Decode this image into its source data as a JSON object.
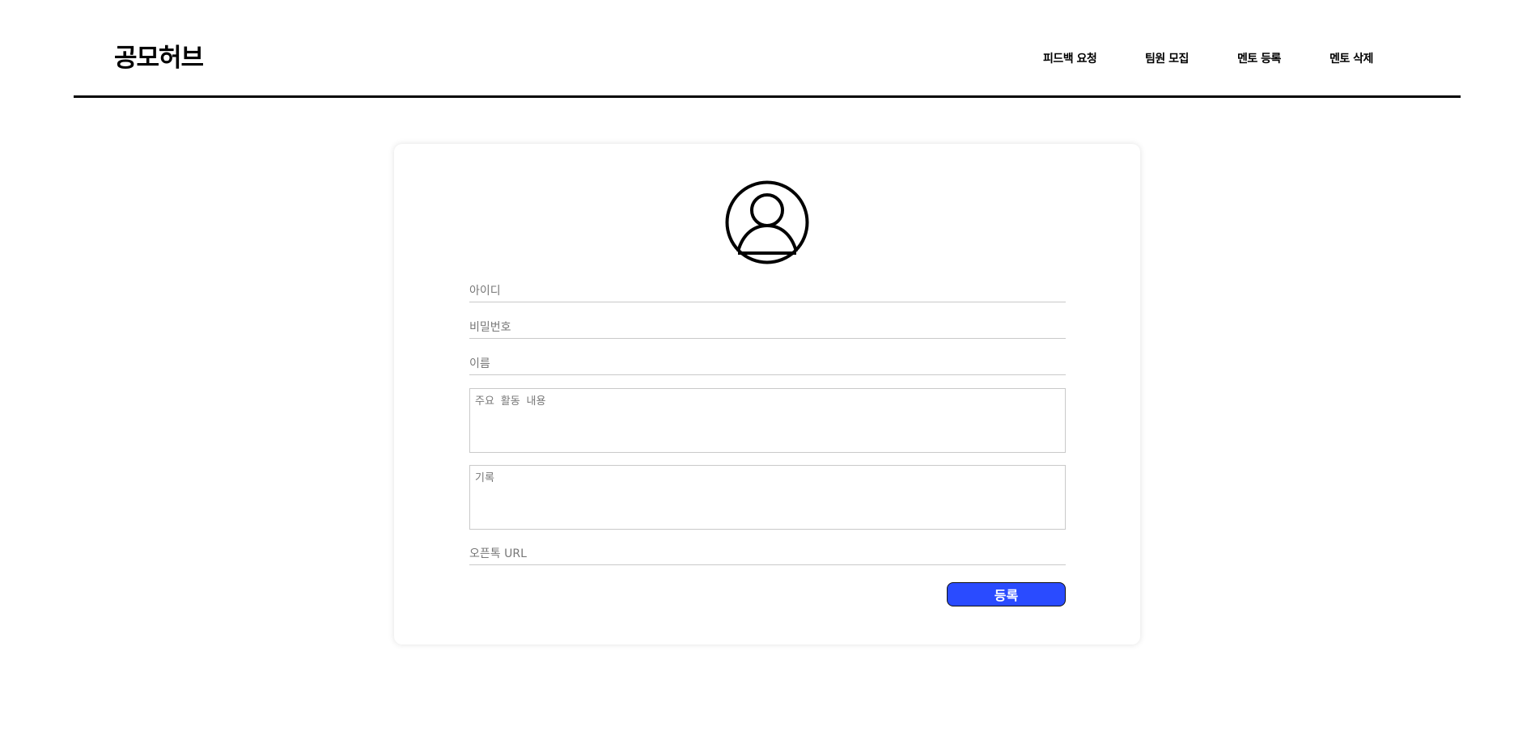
{
  "header": {
    "logo": "공모허브",
    "nav": [
      {
        "label": "피드백 요청"
      },
      {
        "label": "팀원 모집"
      },
      {
        "label": "멘토 등록"
      },
      {
        "label": "멘토 삭제"
      }
    ]
  },
  "form": {
    "avatar_icon": "user-circle-icon",
    "id_placeholder": "아이디",
    "password_placeholder": "비밀번호",
    "name_placeholder": "이름",
    "activity_placeholder": "주요 활동 내용",
    "record_placeholder": "기록",
    "openchat_placeholder": "오픈톡 URL",
    "submit_label": "등록"
  },
  "colors": {
    "accent": "#2a4bff",
    "divider": "#000000",
    "field_border": "#c9c9c9"
  }
}
